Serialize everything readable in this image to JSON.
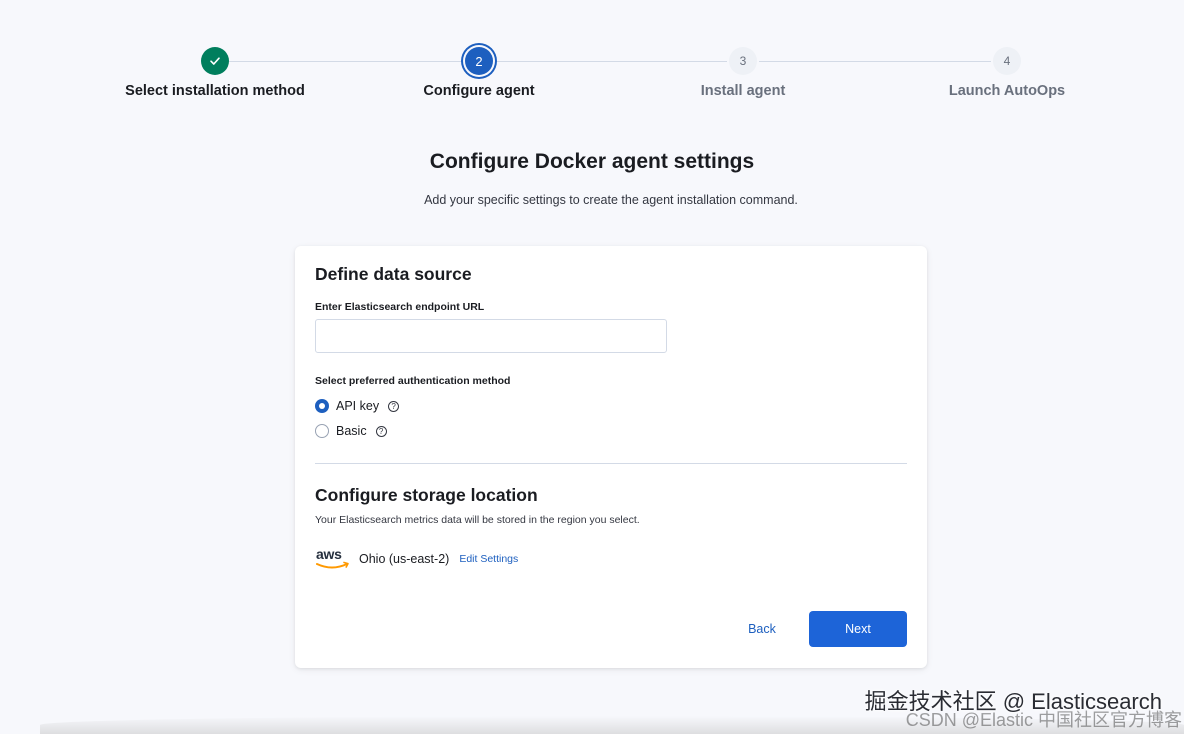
{
  "stepper": {
    "steps": [
      {
        "number": "",
        "label": "Select installation method",
        "state": "complete"
      },
      {
        "number": "2",
        "label": "Configure agent",
        "state": "current"
      },
      {
        "number": "3",
        "label": "Install agent",
        "state": "incomplete"
      },
      {
        "number": "4",
        "label": "Launch AutoOps",
        "state": "incomplete"
      }
    ]
  },
  "page": {
    "title": "Configure Docker agent settings",
    "subtitle": "Add your specific settings to create the agent installation command."
  },
  "data_source": {
    "title": "Define data source",
    "endpoint_label": "Enter Elasticsearch endpoint URL",
    "endpoint_value": "",
    "auth_label": "Select preferred authentication method",
    "auth_options": [
      {
        "label": "API key",
        "selected": true
      },
      {
        "label": "Basic",
        "selected": false
      }
    ]
  },
  "storage": {
    "title": "Configure storage location",
    "description": "Your Elasticsearch metrics data will be stored in the region you select.",
    "provider_logo": "aws",
    "region": "Ohio (us-east-2)",
    "edit_label": "Edit Settings"
  },
  "actions": {
    "back_label": "Back",
    "next_label": "Next"
  },
  "watermark": {
    "line1": "掘金技术社区 @ Elasticsearch",
    "line2": "CSDN @Elastic 中国社区官方博客"
  },
  "colors": {
    "accent": "#1d5fbf",
    "success": "#007e5d",
    "primary_button": "#1d64d8"
  }
}
